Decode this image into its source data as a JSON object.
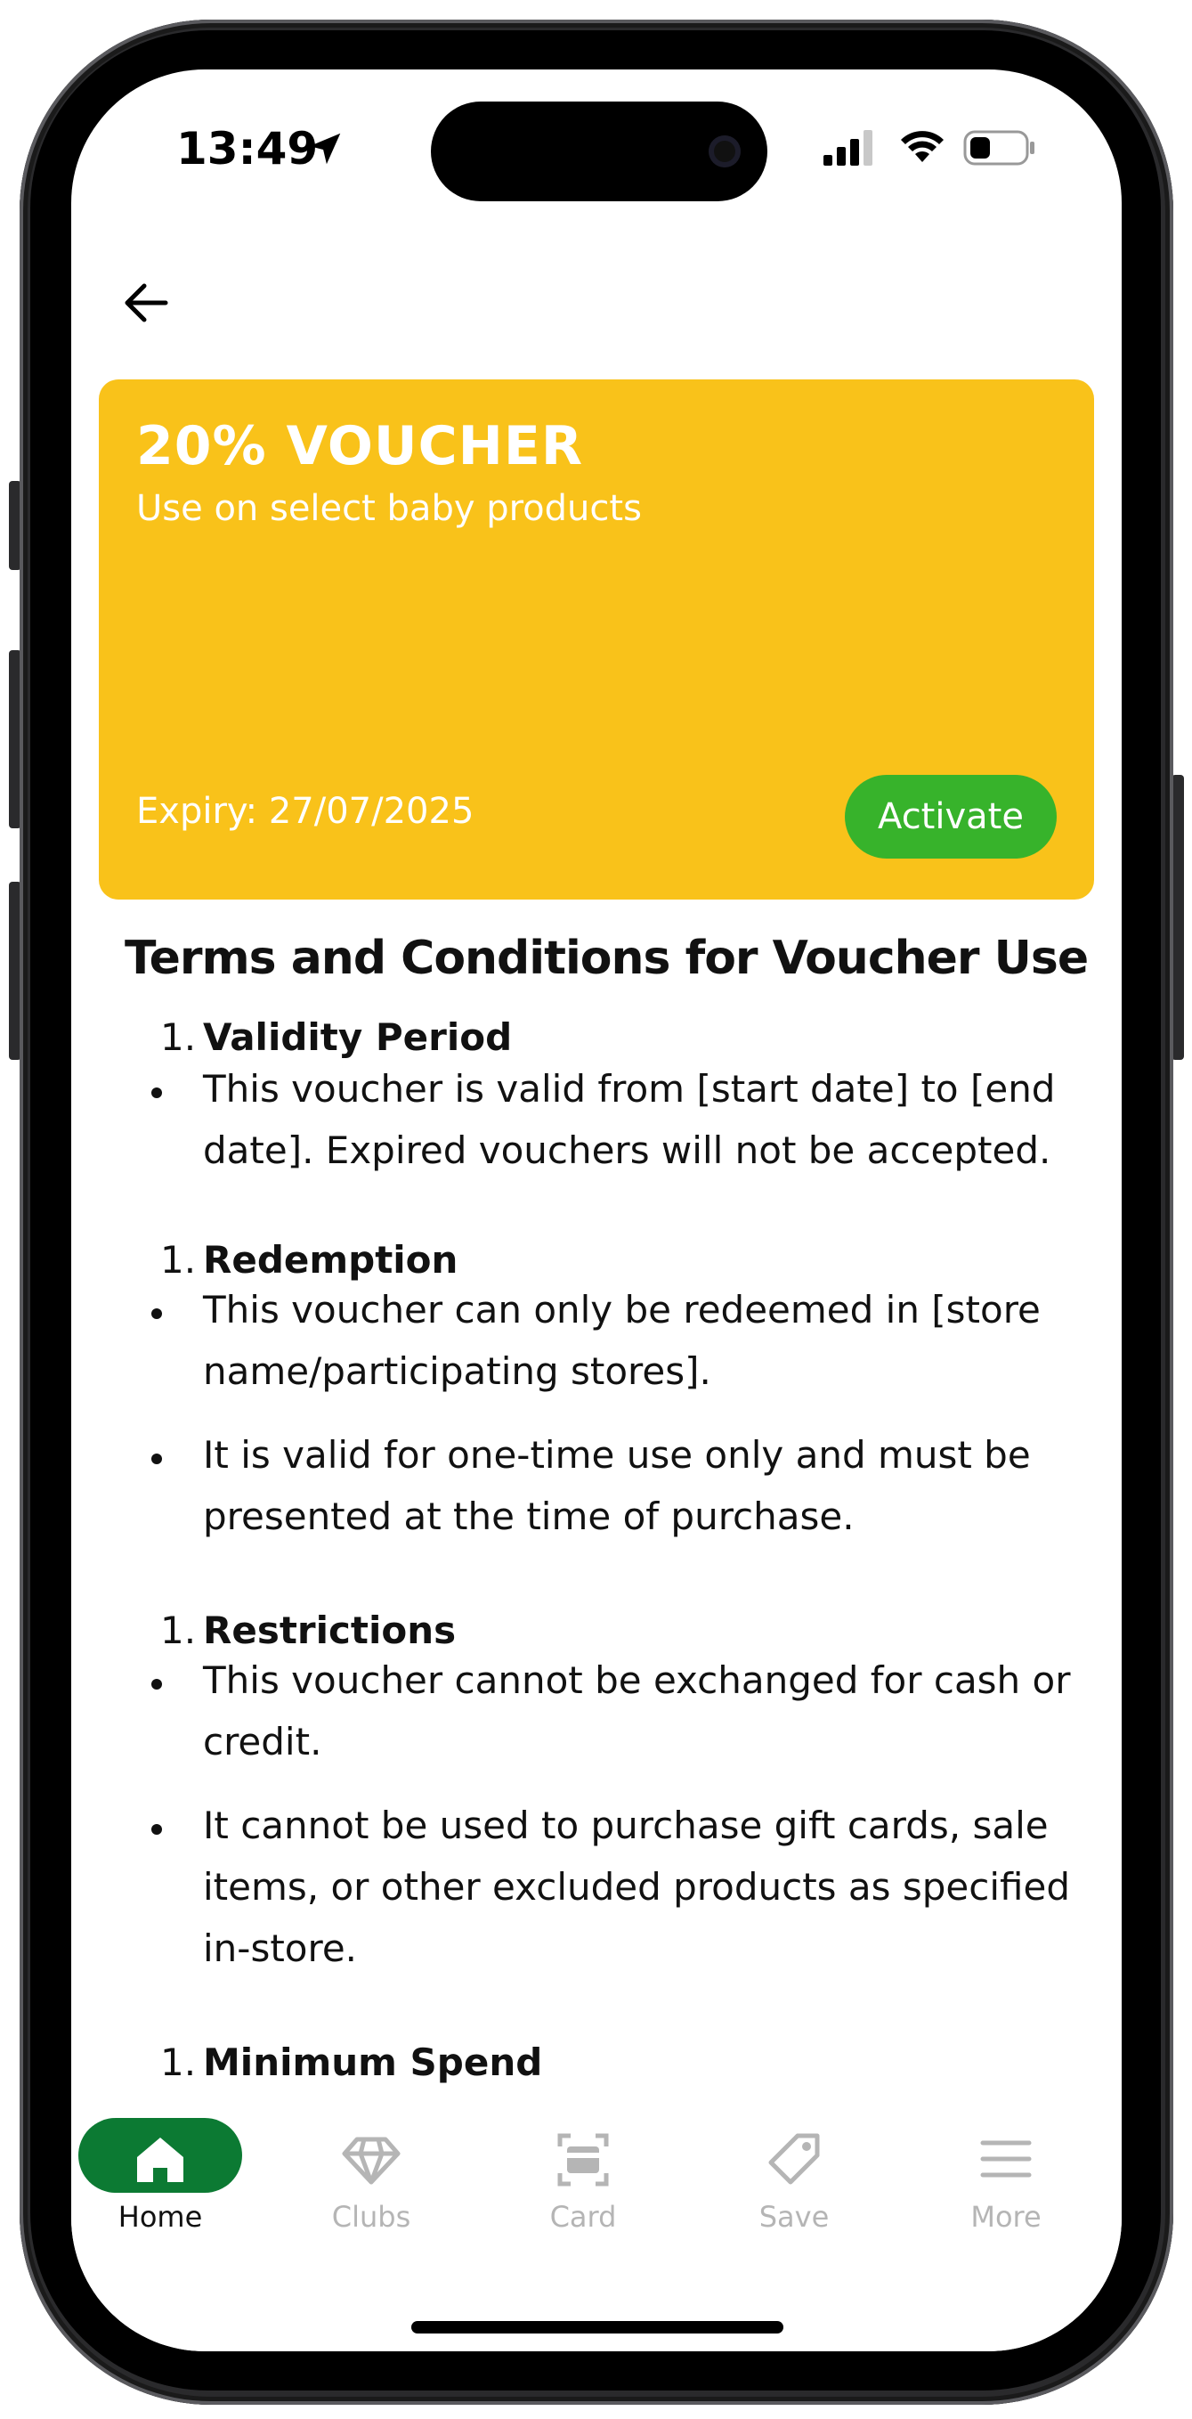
{
  "status_bar": {
    "time": "13:49"
  },
  "voucher": {
    "title": "20% VOUCHER",
    "subtitle": "Use on select baby products",
    "expiry": "Expiry: 27/07/2025",
    "activate_label": "Activate",
    "card_color": "#f9c21a",
    "button_color": "#37b32b"
  },
  "terms": {
    "heading": "Terms and Conditions for Voucher Use",
    "sections": [
      {
        "number": "1.",
        "title": "Validity Period",
        "bullets": [
          "This voucher is valid from [start date] to [end date]. Expired vouchers will not be accepted."
        ]
      },
      {
        "number": "1.",
        "title": "Redemption",
        "bullets": [
          "This voucher can only be redeemed in [store name/participating stores].",
          "It is valid for one-time use only and must be presented at the time of purchase."
        ]
      },
      {
        "number": "1.",
        "title": "Restrictions",
        "bullets": [
          "This voucher cannot be exchanged for cash or credit.",
          "It cannot be used to purchase gift cards, sale items, or other excluded products as specified in-store."
        ]
      },
      {
        "number": "1.",
        "title": "Minimum Spend",
        "bullets": []
      }
    ]
  },
  "tabbar": {
    "accent_color": "#0c7a33",
    "tabs": [
      {
        "label": "Home",
        "icon": "home-icon",
        "active": true
      },
      {
        "label": "Clubs",
        "icon": "diamond-icon",
        "active": false
      },
      {
        "label": "Card",
        "icon": "card-icon",
        "active": false
      },
      {
        "label": "Save",
        "icon": "tag-icon",
        "active": false
      },
      {
        "label": "More",
        "icon": "menu-icon",
        "active": false
      }
    ]
  }
}
